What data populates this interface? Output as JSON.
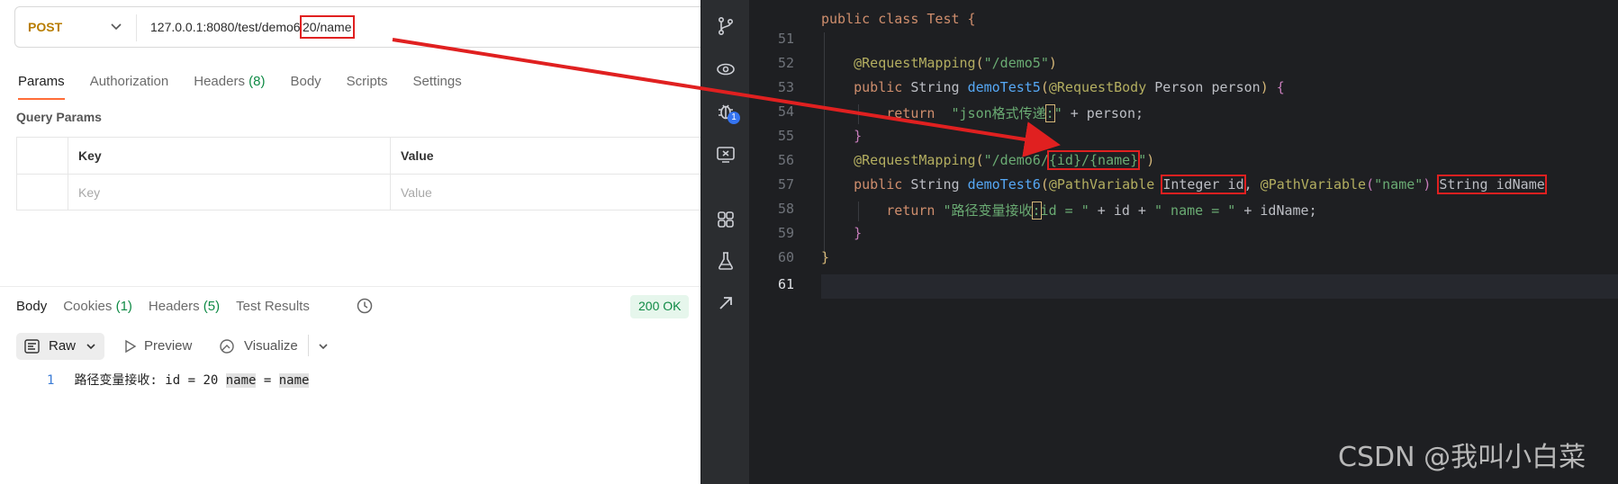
{
  "request": {
    "method": "POST",
    "url_base": "127.0.0.1:8080/test/demo6",
    "url_highlight": "20/name",
    "tabs": [
      {
        "label": "Params",
        "count": ""
      },
      {
        "label": "Authorization",
        "count": ""
      },
      {
        "label": "Headers",
        "count": "(8)"
      },
      {
        "label": "Body",
        "count": ""
      },
      {
        "label": "Scripts",
        "count": ""
      },
      {
        "label": "Settings",
        "count": ""
      }
    ],
    "query_params": {
      "title": "Query Params",
      "col_key": "Key",
      "col_value": "Value",
      "key_placeholder": "Key",
      "value_placeholder": "Value"
    }
  },
  "response": {
    "tabs": [
      {
        "label": "Body",
        "count": ""
      },
      {
        "label": "Cookies",
        "count": "(1)"
      },
      {
        "label": "Headers",
        "count": "(5)"
      },
      {
        "label": "Test Results",
        "count": ""
      }
    ],
    "status": "200 OK",
    "view_mode": "Raw",
    "preview_label": "Preview",
    "visualize_label": "Visualize",
    "line_number": "1",
    "body_prefix": "路径变量接收: id = 20 ",
    "body_name1": "name",
    "body_eq": " = ",
    "body_name2": "name"
  },
  "editor": {
    "lines": [
      "51",
      "52",
      "53",
      "54",
      "55",
      "56",
      "57",
      "58",
      "59",
      "60",
      "61"
    ],
    "class_decl": "public class Test {",
    "mapping5_path": "\"/demo5\"",
    "method5_name": "demoTest5",
    "json_str_a": "\"json格式传递",
    "json_str_b": ":",
    "json_str_c": "\"",
    "mapping6_path_a": "\"/demo6/",
    "mapping6_path_b": "{id}/{name}",
    "mapping6_path_c": "\"",
    "method6_name": "demoTest6",
    "pv_name": "\"name\"",
    "ret_str_a": "\"路径变量接收",
    "ret_str_b": ":",
    "ret_str_c": "id = \"",
    "ret_str_d": "\" name = \""
  },
  "watermark": "CSDN @我叫小白菜",
  "colors": {
    "accent_orange": "#ff6c37",
    "success_green": "#0f8a45",
    "highlight_red": "#e02020",
    "editor_bg": "#1e1f22"
  }
}
